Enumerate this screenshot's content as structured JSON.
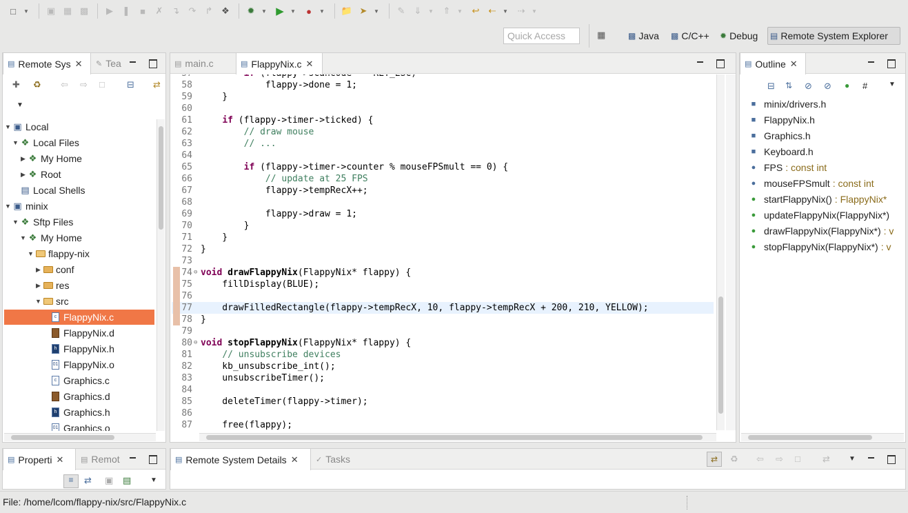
{
  "toolbar": {
    "buttons": [
      "new-icon",
      "save-icon",
      "save-all-icon",
      "print-icon",
      "resume-icon",
      "suspend-icon",
      "terminate-icon",
      "disconnect-icon",
      "step-into-icon",
      "step-over-icon",
      "step-return-icon",
      "debug-icon",
      "run-icon",
      "external-tools-icon",
      "open-type-icon",
      "search-icon",
      "toggle-mark-icon",
      "next-annotation-icon",
      "prev-annotation-icon",
      "last-edit-icon",
      "back-icon",
      "forward-icon"
    ]
  },
  "perspective_bar": {
    "quick_access_placeholder": "Quick Access",
    "perspectives": [
      {
        "label": "Java",
        "active": false
      },
      {
        "label": "C/C++",
        "active": false
      },
      {
        "label": "Debug",
        "active": false
      },
      {
        "label": "Remote System Explorer",
        "active": true
      }
    ]
  },
  "left_panel": {
    "tabs": [
      {
        "label": "Remote Sys",
        "active": true
      },
      {
        "label": "Tea",
        "active": false
      }
    ],
    "tree": [
      {
        "depth": 0,
        "expander": "open",
        "icon": "host",
        "label": "Local"
      },
      {
        "depth": 1,
        "expander": "open",
        "icon": "files",
        "label": "Local Files"
      },
      {
        "depth": 2,
        "expander": "closed",
        "icon": "files",
        "label": "My Home"
      },
      {
        "depth": 2,
        "expander": "closed",
        "icon": "files",
        "label": "Root"
      },
      {
        "depth": 1,
        "expander": "none",
        "icon": "shell",
        "label": "Local Shells"
      },
      {
        "depth": 0,
        "expander": "open",
        "icon": "host",
        "label": "minix"
      },
      {
        "depth": 1,
        "expander": "open",
        "icon": "files",
        "label": "Sftp Files"
      },
      {
        "depth": 2,
        "expander": "open",
        "icon": "files",
        "label": "My Home"
      },
      {
        "depth": 3,
        "expander": "open",
        "icon": "folder-open",
        "label": "flappy-nix"
      },
      {
        "depth": 4,
        "expander": "closed",
        "icon": "folder",
        "label": "conf"
      },
      {
        "depth": 4,
        "expander": "closed",
        "icon": "folder",
        "label": "res"
      },
      {
        "depth": 4,
        "expander": "open",
        "icon": "folder-open",
        "label": "src"
      },
      {
        "depth": 5,
        "expander": "none",
        "icon": "c-file",
        "label": "FlappyNix.c",
        "selected": true
      },
      {
        "depth": 5,
        "expander": "none",
        "icon": "obj-file",
        "label": "FlappyNix.d"
      },
      {
        "depth": 5,
        "expander": "none",
        "icon": "h-file",
        "label": "FlappyNix.h"
      },
      {
        "depth": 5,
        "expander": "none",
        "icon": "o-file",
        "label": "FlappyNix.o"
      },
      {
        "depth": 5,
        "expander": "none",
        "icon": "c-file",
        "label": "Graphics.c"
      },
      {
        "depth": 5,
        "expander": "none",
        "icon": "obj-file",
        "label": "Graphics.d"
      },
      {
        "depth": 5,
        "expander": "none",
        "icon": "h-file",
        "label": "Graphics.h"
      },
      {
        "depth": 5,
        "expander": "none",
        "icon": "o-file",
        "label": "Graphics.o"
      }
    ]
  },
  "editor": {
    "tabs": [
      {
        "label": "main.c",
        "active": false
      },
      {
        "label": "FlappyNix.c",
        "active": true
      }
    ],
    "first_partial_line": {
      "number": "57",
      "text": "        if (flappy->scancode == KEY_ESC)"
    },
    "lines": [
      {
        "n": "58",
        "t": "            flappy->done = 1;"
      },
      {
        "n": "59",
        "t": "    }"
      },
      {
        "n": "60",
        "t": ""
      },
      {
        "n": "61",
        "t": "    if (flappy->timer->ticked) {"
      },
      {
        "n": "62",
        "t": "        // draw mouse"
      },
      {
        "n": "63",
        "t": "        // ..."
      },
      {
        "n": "64",
        "t": ""
      },
      {
        "n": "65",
        "t": "        if (flappy->timer->counter % mouseFPSmult == 0) {"
      },
      {
        "n": "66",
        "t": "            // update at 25 FPS"
      },
      {
        "n": "67",
        "t": "            flappy->tempRecX++;"
      },
      {
        "n": "68",
        "t": ""
      },
      {
        "n": "69",
        "t": "            flappy->draw = 1;"
      },
      {
        "n": "70",
        "t": "        }"
      },
      {
        "n": "71",
        "t": "    }"
      },
      {
        "n": "72",
        "t": "}"
      },
      {
        "n": "73",
        "t": ""
      },
      {
        "n": "74",
        "t": "void drawFlappyNix(FlappyNix* flappy) {"
      },
      {
        "n": "75",
        "t": "    fillDisplay(BLUE);"
      },
      {
        "n": "76",
        "t": ""
      },
      {
        "n": "77",
        "t": "    drawFilledRectangle(flappy->tempRecX, 10, flappy->tempRecX + 200, 210, YELLOW);"
      },
      {
        "n": "78",
        "t": "}"
      },
      {
        "n": "79",
        "t": ""
      },
      {
        "n": "80",
        "t": "void stopFlappyNix(FlappyNix* flappy) {"
      },
      {
        "n": "81",
        "t": "    // unsubscribe devices"
      },
      {
        "n": "82",
        "t": "    kb_unsubscribe_int();"
      },
      {
        "n": "83",
        "t": "    unsubscribeTimer();"
      },
      {
        "n": "84",
        "t": ""
      },
      {
        "n": "85",
        "t": "    deleteTimer(flappy->timer);"
      },
      {
        "n": "86",
        "t": ""
      },
      {
        "n": "87",
        "t": "    free(flappy);"
      }
    ],
    "current_line": "77"
  },
  "outline": {
    "tab_label": "Outline",
    "items": [
      {
        "icon": "include",
        "name": "minix/drivers.h",
        "type": ""
      },
      {
        "icon": "include",
        "name": "FlappyNix.h",
        "type": ""
      },
      {
        "icon": "include",
        "name": "Graphics.h",
        "type": ""
      },
      {
        "icon": "include",
        "name": "Keyboard.h",
        "type": ""
      },
      {
        "icon": "const",
        "name": "FPS",
        "type": ": const int"
      },
      {
        "icon": "const",
        "name": "mouseFPSmult",
        "type": ": const int"
      },
      {
        "icon": "function",
        "name": "startFlappyNix()",
        "type": ": FlappyNix*"
      },
      {
        "icon": "function",
        "name": "updateFlappyNix(FlappyNix*)",
        "type": ""
      },
      {
        "icon": "function",
        "name": "drawFlappyNix(FlappyNix*)",
        "type": ": v"
      },
      {
        "icon": "function",
        "name": "stopFlappyNix(FlappyNix*)",
        "type": ": v"
      }
    ]
  },
  "bottom_left": {
    "tabs": [
      {
        "label": "Properti",
        "active": true
      },
      {
        "label": "Remot",
        "active": false
      }
    ]
  },
  "bottom_right": {
    "tabs": [
      {
        "label": "Remote System Details",
        "active": true
      },
      {
        "label": "Tasks",
        "active": false
      }
    ]
  },
  "status_bar": {
    "text": "File: /home/lcom/flappy-nix/src/FlappyNix.c"
  },
  "colors": {
    "selection": "#f07746",
    "keyword": "#7f0055",
    "comment": "#3f7f5f",
    "current_line": "#e8f2fe"
  }
}
